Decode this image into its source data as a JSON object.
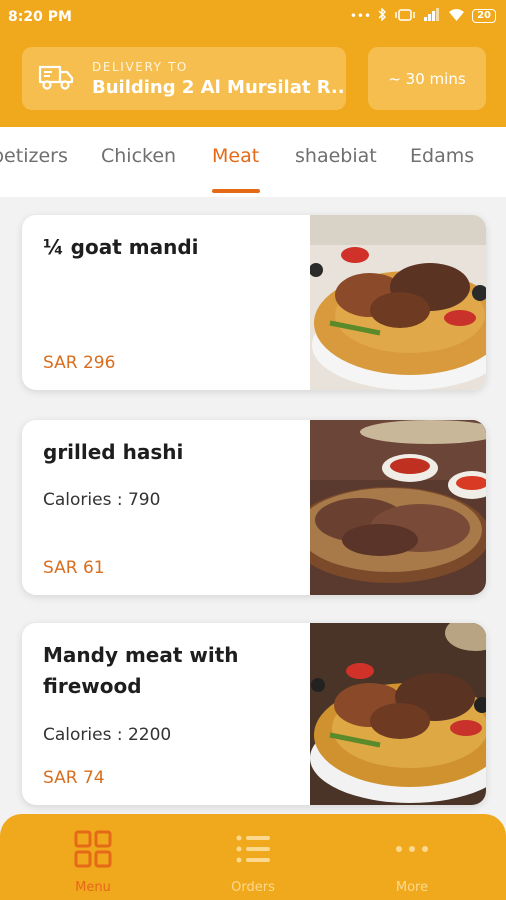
{
  "status": {
    "time": "8:20 PM",
    "battery": "20"
  },
  "delivery": {
    "label": "DELIVERY TO",
    "address": "Building 2 Al Mursilat R...",
    "eta": "~ 30 mins"
  },
  "tabs": [
    {
      "label": "petizers"
    },
    {
      "label": "Chicken"
    },
    {
      "label": "Meat",
      "active": true
    },
    {
      "label": "shaebiat"
    },
    {
      "label": "Edams"
    }
  ],
  "items": [
    {
      "name": "¼ goat mandi",
      "calories": "",
      "price": "SAR 296"
    },
    {
      "name": "grilled hashi",
      "calories": "Calories : 790",
      "price": "SAR 61"
    },
    {
      "name": "Mandy meat with firewood",
      "calories": "Calories : 2200",
      "price": "SAR 74"
    }
  ],
  "nav": [
    {
      "label": "Menu",
      "icon": "grid-icon",
      "active": true
    },
    {
      "label": "Orders",
      "icon": "list-icon"
    },
    {
      "label": "More",
      "icon": "more-dots-icon"
    }
  ],
  "colors": {
    "primary": "#f0a81c",
    "accent": "#e46a18",
    "price": "#d96e1e"
  }
}
